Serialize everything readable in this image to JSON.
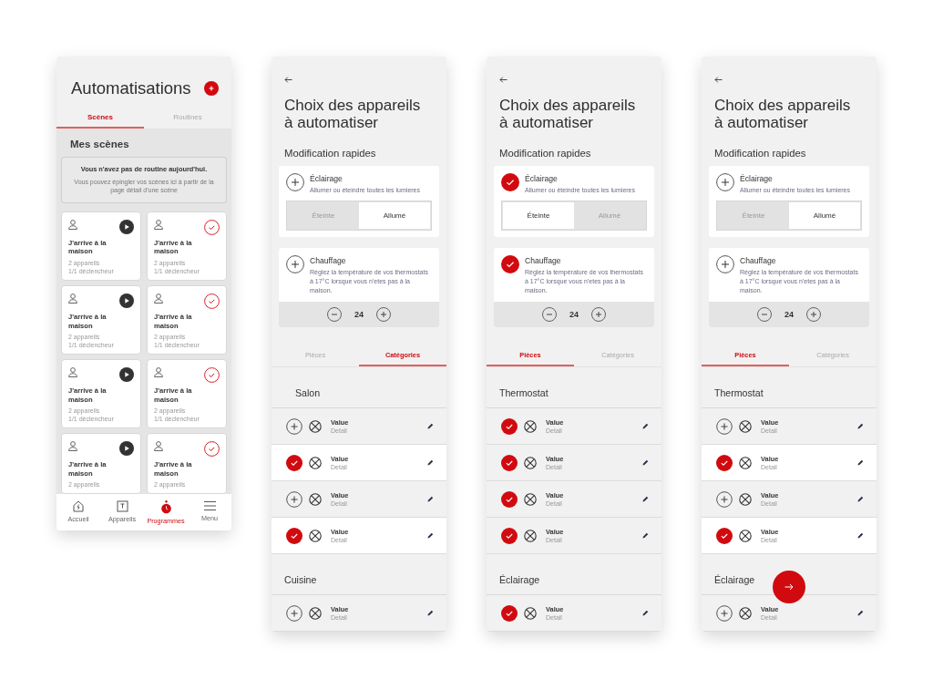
{
  "screens": [
    {
      "kind": "scenes",
      "title": "Automatisations",
      "tabs": [
        {
          "label": "Scènes",
          "selected": true
        },
        {
          "label": "Routines",
          "selected": false
        }
      ],
      "section_title": "Mes scènes",
      "notice": {
        "title": "Vous n'avez pas de routine aujourd'hui.",
        "text": "Vous pouvez épingler vos scènes ici à partir de la page détail d'une scène"
      },
      "cards": [
        {
          "kind": "play",
          "title": "J'arrive à la maison",
          "lines": [
            "2 appareils",
            "1/1 déclencheur"
          ]
        },
        {
          "kind": "check",
          "title": "J'arrive à la maison",
          "lines": [
            "2 appareils",
            "1/1 déclencheur"
          ]
        },
        {
          "kind": "play",
          "title": "J'arrive à la maison",
          "lines": [
            "2 appareils",
            "1/1 déclencheur"
          ]
        },
        {
          "kind": "check",
          "title": "J'arrive à la maison",
          "lines": [
            "2 appareils",
            "1/1 déclencheur"
          ]
        },
        {
          "kind": "play",
          "title": "J'arrive à la maison",
          "lines": [
            "2 appareils",
            "1/1 déclencheur"
          ]
        },
        {
          "kind": "check",
          "title": "J'arrive à la maison",
          "lines": [
            "2 appareils",
            "1/1 déclencheur"
          ]
        },
        {
          "kind": "play",
          "title": "J'arrive à la maison",
          "lines": [
            "2 appareils"
          ]
        },
        {
          "kind": "check",
          "title": "J'arrive à la maison",
          "lines": [
            "2 appareils"
          ]
        }
      ],
      "nav": [
        {
          "kind": "home",
          "label": "Accueil",
          "selected": false
        },
        {
          "kind": "device",
          "label": "Appareils",
          "selected": false
        },
        {
          "kind": "clock",
          "label": "Programmes",
          "selected": true
        },
        {
          "kind": "menu",
          "label": "Menu",
          "selected": false
        }
      ]
    },
    {
      "kind": "devices",
      "title": "Choix des appareils à automatiser",
      "subtitle": "Modification rapides",
      "lighting": {
        "title": "Éclairage",
        "text": "Allumer ou éteindre toutes les lumieres",
        "checked": false,
        "options": [
          {
            "label": "Éteinte",
            "selected": false
          },
          {
            "label": "Allumé",
            "selected": true
          }
        ]
      },
      "heating": {
        "title": "Chauffage",
        "text": "Réglez la température de vos thermostats à 17°C lorsque vous n'etes pas à la maison.",
        "checked": false,
        "value": "24"
      },
      "tabs": [
        {
          "label": "Pièces",
          "selected": false
        },
        {
          "label": "Catégories",
          "selected": true
        }
      ],
      "groups": [
        {
          "title": "Salon",
          "rows": [
            {
              "value": "Value",
              "detail": "Detail",
              "checked": false,
              "selected": false
            },
            {
              "value": "Value",
              "detail": "Detail",
              "checked": true,
              "selected": true
            },
            {
              "value": "Value",
              "detail": "Detail",
              "checked": false,
              "selected": false
            },
            {
              "value": "Value",
              "detail": "Detail",
              "checked": true,
              "selected": true
            }
          ]
        },
        {
          "title": "Cuisine",
          "rows": [
            {
              "value": "Value",
              "detail": "Detail",
              "checked": false,
              "selected": false
            }
          ]
        }
      ]
    },
    {
      "kind": "devices",
      "title": "Choix des appareils à automatiser",
      "subtitle": "Modification rapides",
      "lighting": {
        "title": "Éclairage",
        "text": "Allumer ou éteindre toutes les lumieres",
        "checked": true,
        "options": [
          {
            "label": "Éteinte",
            "selected": true
          },
          {
            "label": "Allumé",
            "selected": false
          }
        ]
      },
      "heating": {
        "title": "Chauffage",
        "text": "Réglez la température de vos thermostats à 17°C lorsque vous n'etes pas à la maison.",
        "checked": true,
        "value": "24"
      },
      "tabs": [
        {
          "label": "Pièces",
          "selected": true
        },
        {
          "label": "Catégories",
          "selected": false
        }
      ],
      "groups": [
        {
          "title": "Thermostat",
          "rows": [
            {
              "value": "Value",
              "detail": "Detail",
              "checked": true,
              "selected": false
            },
            {
              "value": "Value",
              "detail": "Detail",
              "checked": true,
              "selected": false
            },
            {
              "value": "Value",
              "detail": "Detail",
              "checked": true,
              "selected": false
            },
            {
              "value": "Value",
              "detail": "Detail",
              "checked": true,
              "selected": false
            }
          ]
        },
        {
          "title": "Éclairage",
          "rows": [
            {
              "value": "Value",
              "detail": "Detail",
              "checked": true,
              "selected": false
            }
          ]
        }
      ]
    },
    {
      "kind": "devices",
      "title": "Choix des appareils à automatiser",
      "subtitle": "Modification rapides",
      "lighting": {
        "title": "Éclairage",
        "text": "Allumer ou éteindre toutes les lumieres",
        "checked": false,
        "options": [
          {
            "label": "Éteinte",
            "selected": false
          },
          {
            "label": "Allumé",
            "selected": true
          }
        ]
      },
      "heating": {
        "title": "Chauffage",
        "text": "Réglez la température de vos thermostats à 17°C lorsque vous n'etes pas à la maison.",
        "checked": false,
        "value": "24"
      },
      "tabs": [
        {
          "label": "Pièces",
          "selected": true
        },
        {
          "label": "Catégories",
          "selected": false
        }
      ],
      "groups": [
        {
          "title": "Thermostat",
          "rows": [
            {
              "value": "Value",
              "detail": "Detail",
              "checked": false,
              "selected": false
            },
            {
              "value": "Value",
              "detail": "Detail",
              "checked": true,
              "selected": true
            },
            {
              "value": "Value",
              "detail": "Detail",
              "checked": false,
              "selected": false
            },
            {
              "value": "Value",
              "detail": "Detail",
              "checked": true,
              "selected": true
            }
          ]
        },
        {
          "title": "Éclairage",
          "rows": [
            {
              "value": "Value",
              "detail": "Detail",
              "checked": false,
              "selected": false
            }
          ]
        }
      ],
      "fab": true
    }
  ]
}
